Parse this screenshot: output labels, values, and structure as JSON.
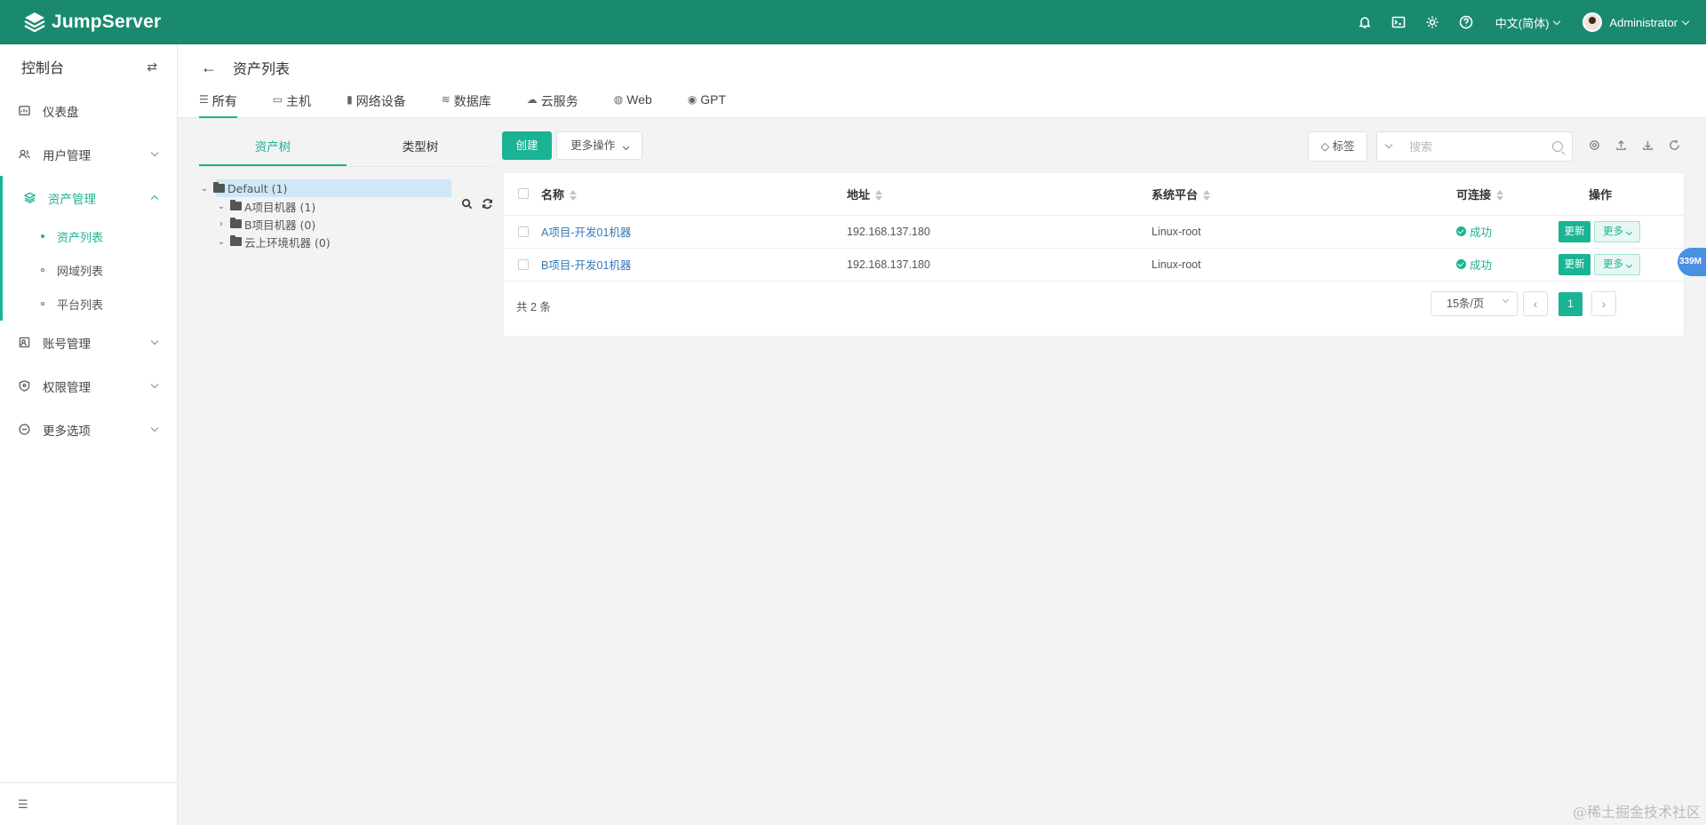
{
  "app": {
    "name": "JumpServer"
  },
  "topbar": {
    "language": "中文(简体)",
    "user": "Administrator",
    "icons": [
      "bell-icon",
      "terminal-icon",
      "gear-icon",
      "help-icon"
    ]
  },
  "sidebar": {
    "title": "控制台",
    "items": [
      {
        "label": "仪表盘",
        "icon": "dashboard-icon"
      },
      {
        "label": "用户管理",
        "icon": "users-icon"
      },
      {
        "label": "资产管理",
        "icon": "layers-icon"
      },
      {
        "label": "账号管理",
        "icon": "accounts-icon"
      },
      {
        "label": "权限管理",
        "icon": "shield-icon"
      },
      {
        "label": "更多选项",
        "icon": "more-icon"
      }
    ],
    "subitems": [
      "资产列表",
      "网域列表",
      "平台列表"
    ]
  },
  "page": {
    "title": "资产列表",
    "tabs": [
      "所有",
      "主机",
      "网络设备",
      "数据库",
      "云服务",
      "Web",
      "GPT"
    ]
  },
  "tree": {
    "tabs": [
      "资产树",
      "类型树"
    ],
    "nodes": [
      "Default (1)",
      "A项目机器 (1)",
      "B项目机器 (0)",
      "云上环境机器 (0)"
    ]
  },
  "toolbar": {
    "create": "创建",
    "more_actions": "更多操作",
    "tags": "标签",
    "search_placeholder": "搜索"
  },
  "table": {
    "columns": [
      "名称",
      "地址",
      "系统平台",
      "可连接",
      "操作"
    ],
    "rows": [
      {
        "name": "A项目-开发01机器",
        "address": "192.168.137.180",
        "platform": "Linux-root",
        "status": "成功"
      },
      {
        "name": "B项目-开发01机器",
        "address": "192.168.137.180",
        "platform": "Linux-root",
        "status": "成功"
      }
    ],
    "update_label": "更新",
    "more_label": "更多"
  },
  "pagination": {
    "total": "共 2 条",
    "page_size": "15条/页",
    "current": "1"
  },
  "float_badge": "339M",
  "watermark": "@稀土掘金技术社区",
  "colors": {
    "brand": "#1a8a6f",
    "accent": "#1ab394",
    "link": "#337ab7"
  }
}
